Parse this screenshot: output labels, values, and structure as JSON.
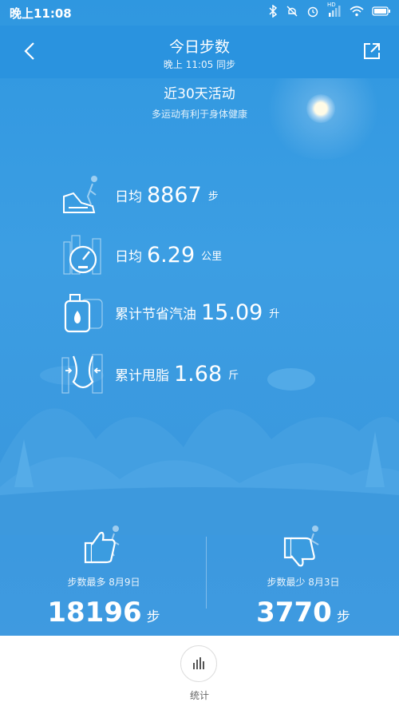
{
  "status_bar": {
    "time": "晚上11:08",
    "hd_badge": "HD"
  },
  "header": {
    "title": "今日步数",
    "subtitle": "晚上 11:05 同步",
    "back_icon": "chevron-left-icon",
    "share_icon": "share-icon"
  },
  "summary": {
    "title": "近30天活动",
    "subtitle": "多运动有利于身体健康"
  },
  "stats": [
    {
      "label": "日均",
      "value": "8867",
      "unit": "步",
      "icon": "shoe-walker-icon"
    },
    {
      "label": "日均",
      "value": "6.29",
      "unit": "公里",
      "icon": "speedometer-city-icon"
    },
    {
      "label": "累计节省汽油",
      "value": "15.09",
      "unit": "升",
      "icon": "fuel-can-icon"
    },
    {
      "label": "累计甩脂",
      "value": "1.68",
      "unit": "斤",
      "icon": "waist-icon"
    }
  ],
  "extremes": {
    "max": {
      "label": "步数最多 8月9日",
      "value": "18196",
      "unit": "步",
      "icon": "thumbs-up-icon"
    },
    "min": {
      "label": "步数最少 8月3日",
      "value": "3770",
      "unit": "步",
      "icon": "thumbs-down-icon"
    }
  },
  "bottom_nav": {
    "label": "统计",
    "icon": "bar-chart-icon"
  },
  "colors": {
    "background": "#3a9ae0",
    "topbar": "#2a93df",
    "text": "#ffffff"
  }
}
